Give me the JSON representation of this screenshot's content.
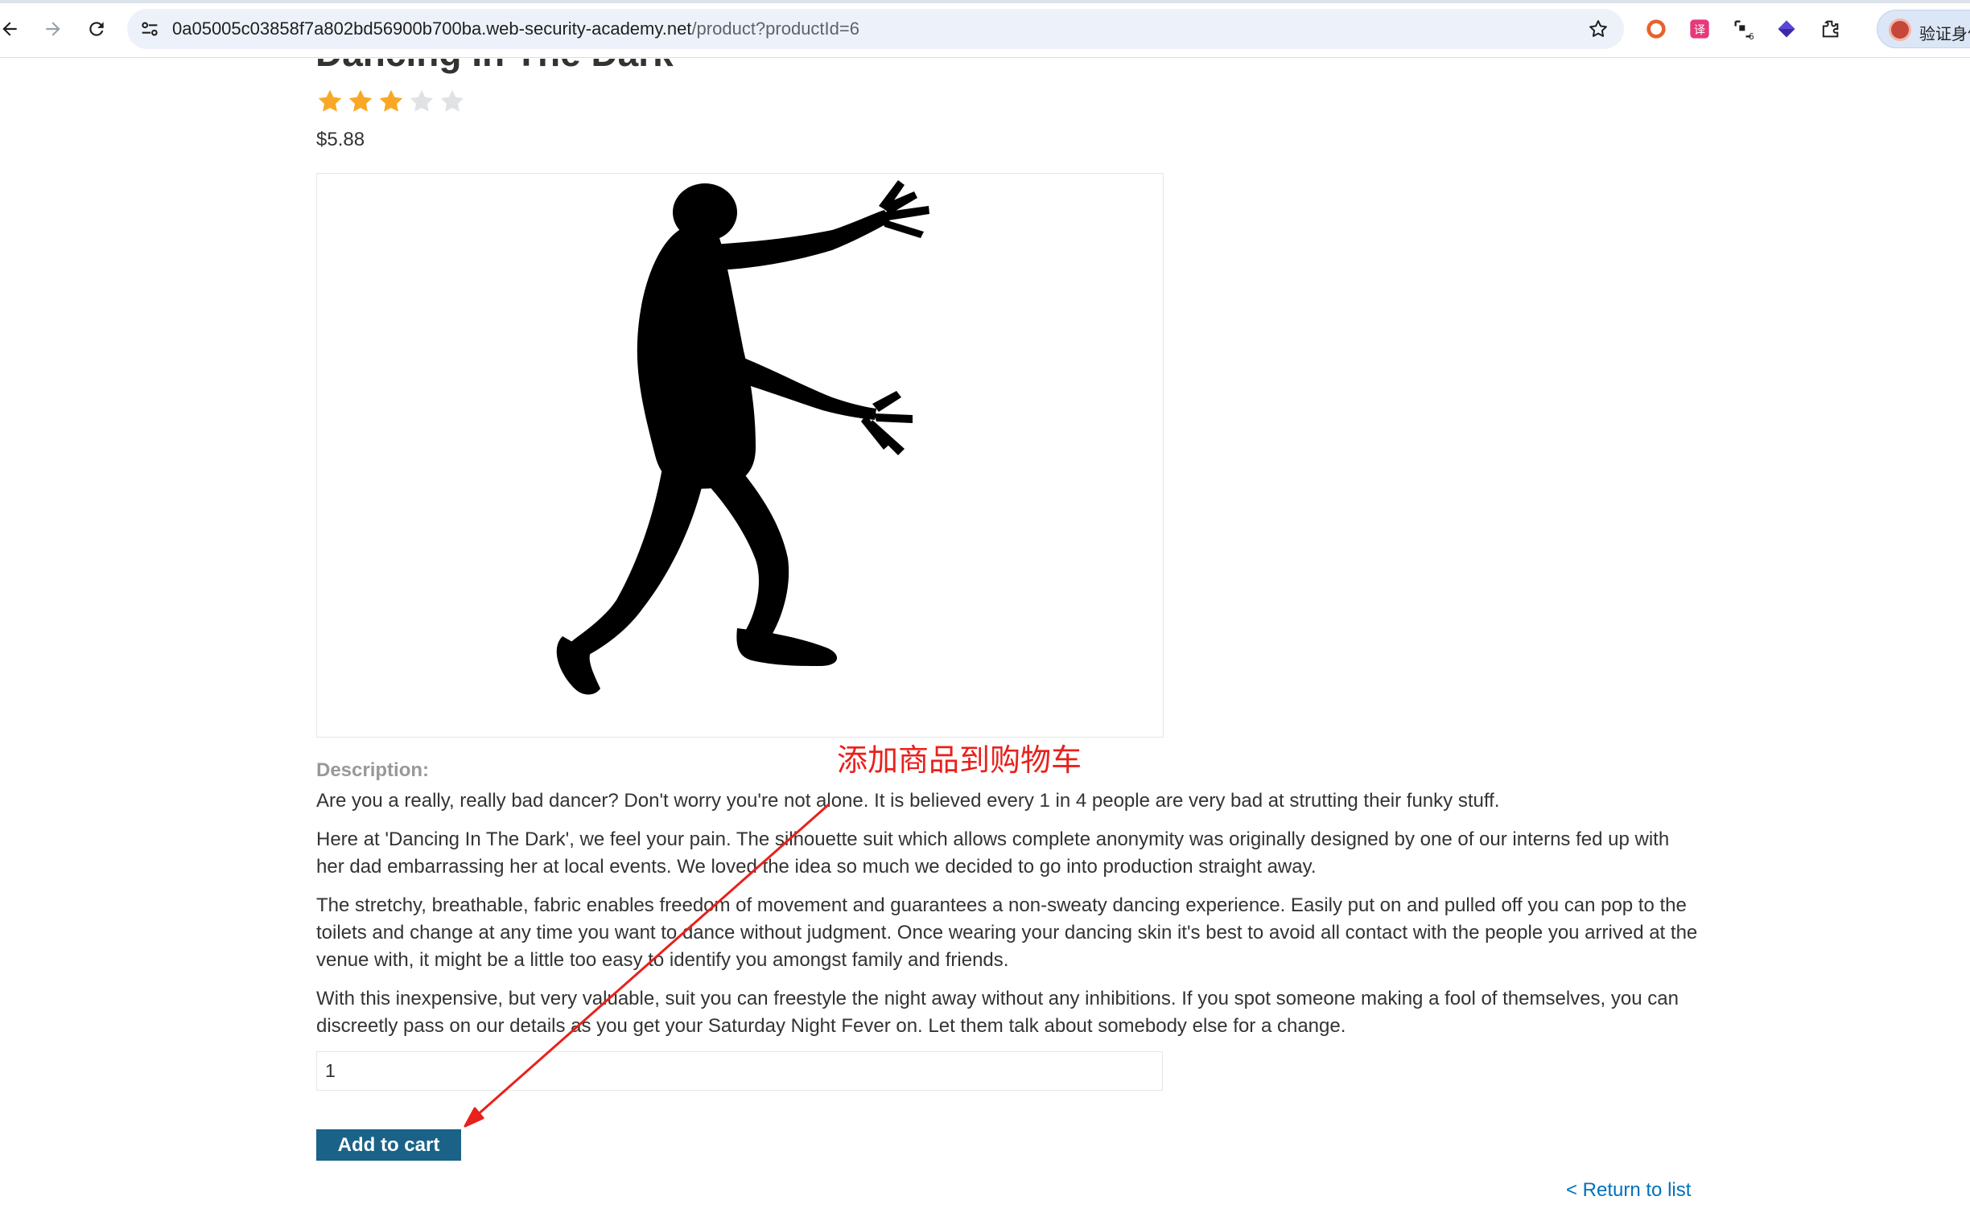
{
  "browser": {
    "url_host": "0a05005c03858f7a802bd56900b700ba.web-security-academy.net",
    "url_path": "/product?productId=6",
    "profile_label": "验证身份"
  },
  "product": {
    "title": "Dancing In The Dark",
    "rating": {
      "value": 3,
      "max": 5
    },
    "price": "$5.88",
    "description_label": "Description:",
    "description": [
      "Are you a really, really bad dancer? Don't worry you're not alone. It is believed every 1 in 4 people are very bad at strutting their funky stuff.",
      "Here at 'Dancing In The Dark', we feel your pain. The silhouette suit which allows complete anonymity was originally designed by one of our interns fed up with her dad embarrassing her at local events. We loved the idea so much we decided to go into production straight away.",
      "The stretchy, breathable, fabric enables freedom of movement and guarantees a non-sweaty dancing experience. Easily put on and pulled off you can pop to the toilets and change at any time you want to dance without judgment. Once wearing your dancing skin it's best to avoid all contact with the people you arrived at the venue with, it might be a little too easy to identify you amongst family and friends.",
      "With this inexpensive, but very valuable, suit you can freestyle the night away without any inhibitions. If you spot someone making a fool of themselves, you can discreetly pass on our details as you get your Saturday Night Fever on. Let them talk about somebody else for a change."
    ],
    "quantity": "1",
    "add_to_cart_label": "Add to cart",
    "return_link_label": "< Return to list"
  },
  "annotation": {
    "text": "添加商品到购物车",
    "color": "#e8211c"
  },
  "colors": {
    "star_filled": "#f9a825",
    "star_empty": "#dfe3e6",
    "button": "#1b6288",
    "link": "#0071bc"
  }
}
